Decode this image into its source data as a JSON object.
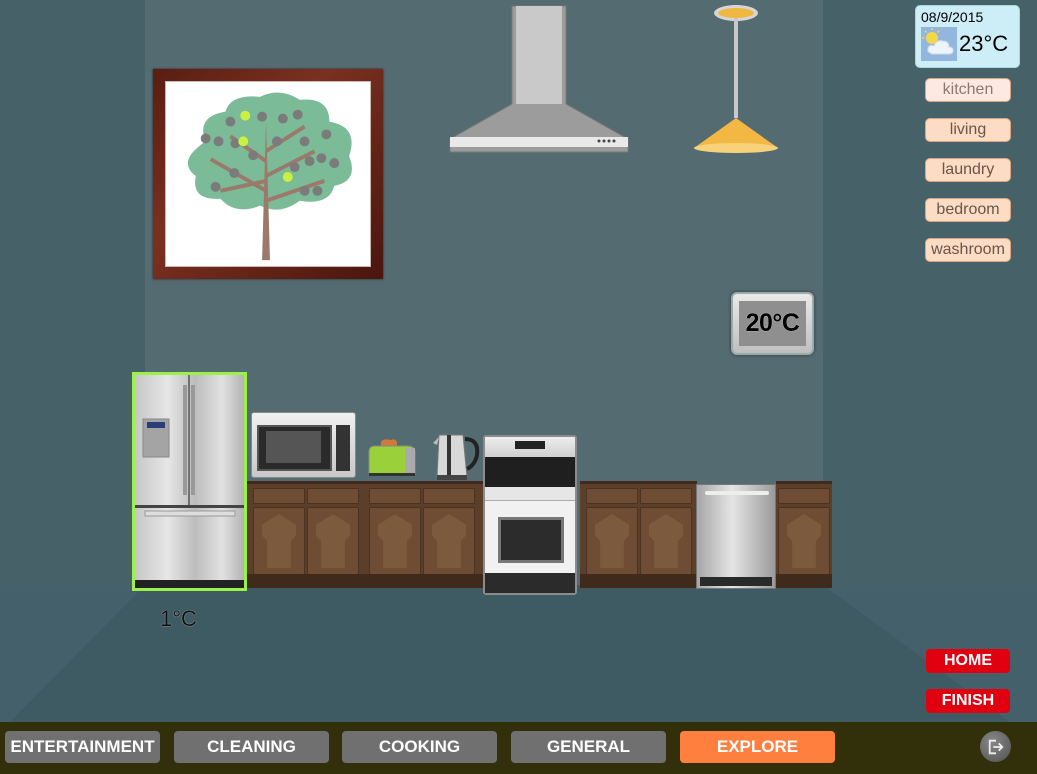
{
  "weather": {
    "date": "08/9/2015",
    "temperature": "23°C",
    "icon": "partly-cloudy-icon"
  },
  "rooms": [
    {
      "label": "kitchen",
      "active": true
    },
    {
      "label": "living",
      "active": false
    },
    {
      "label": "laundry",
      "active": false
    },
    {
      "label": "bedroom",
      "active": false
    },
    {
      "label": "washroom",
      "active": false
    }
  ],
  "thermostat": {
    "temperature": "20°C"
  },
  "fridge": {
    "temperature": "1°C",
    "selected": true
  },
  "actions": {
    "home": "HOME",
    "finish": "FINISH"
  },
  "categories": [
    {
      "label": "ENTERTAINMENT",
      "active": false
    },
    {
      "label": "CLEANING",
      "active": false
    },
    {
      "label": "COOKING",
      "active": false
    },
    {
      "label": "GENERAL",
      "active": false
    },
    {
      "label": "EXPLORE",
      "active": true
    }
  ],
  "exit": {
    "icon": "exit-icon"
  },
  "colors": {
    "active_category": "#ff7f3f",
    "inactive_category": "#707070",
    "action_red": "#e00010",
    "selection_green": "#9bf04a",
    "room_button": "#fcdcc4"
  }
}
